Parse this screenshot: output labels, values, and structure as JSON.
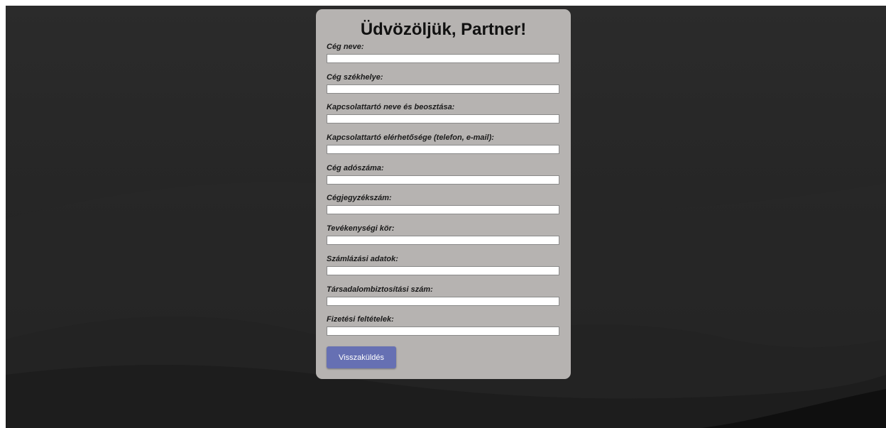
{
  "form": {
    "title": "Üdvözöljük, Partner!",
    "fields": [
      {
        "label": "Cég neve:",
        "value": ""
      },
      {
        "label": "Cég székhelye:",
        "value": ""
      },
      {
        "label": "Kapcsolattartó neve és beosztása:",
        "value": ""
      },
      {
        "label": "Kapcsolattartó elérhetősége (telefon, e-mail):",
        "value": ""
      },
      {
        "label": "Cég adószáma:",
        "value": ""
      },
      {
        "label": "Cégjegyzékszám:",
        "value": ""
      },
      {
        "label": "Tevékenységi kör:",
        "value": ""
      },
      {
        "label": "Számlázási adatok:",
        "value": ""
      },
      {
        "label": "Társadalombiztosítási szám:",
        "value": ""
      },
      {
        "label": "Fizetési feltételek:",
        "value": ""
      }
    ],
    "submit_label": "Visszaküldés"
  },
  "colors": {
    "background": "#262626",
    "card": "#b6b3b1",
    "button": "#6670b3",
    "button_text": "#ffffff"
  }
}
